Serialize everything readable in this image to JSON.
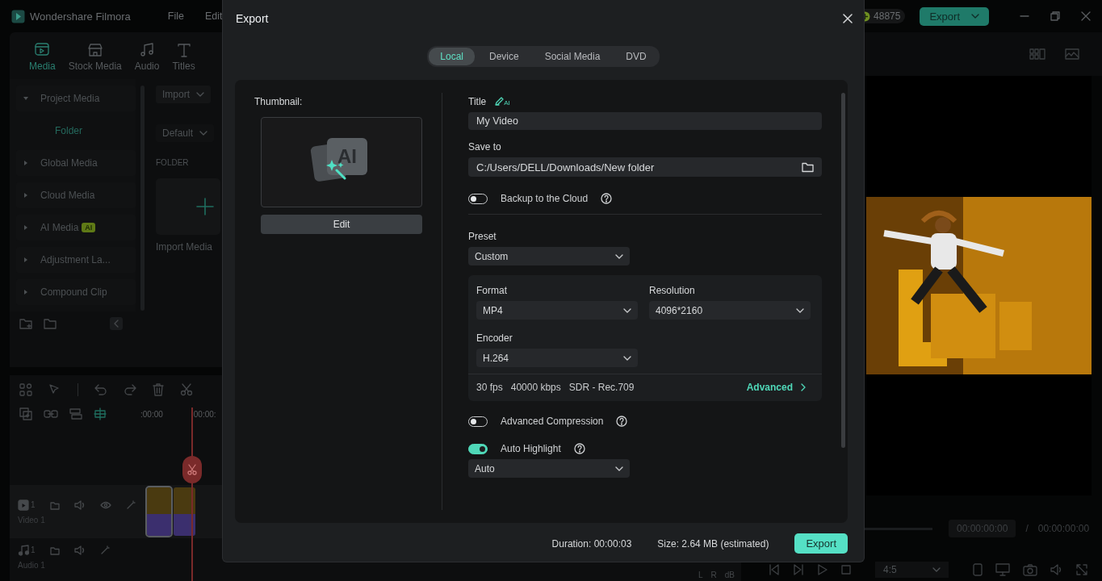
{
  "app": {
    "title": "Wondershare Filmora",
    "menu": [
      "File",
      "Edit"
    ],
    "credits": "48875",
    "export_button": "Export"
  },
  "media_tabs": [
    {
      "label": "Media",
      "selected": true
    },
    {
      "label": "Stock Media",
      "selected": false
    },
    {
      "label": "Audio",
      "selected": false
    },
    {
      "label": "Titles",
      "selected": false
    }
  ],
  "sidebar": {
    "items": [
      {
        "label": "Project Media",
        "expanded": true,
        "children": [
          {
            "label": "Folder",
            "selected": true
          }
        ]
      },
      {
        "label": "Global Media",
        "expanded": false
      },
      {
        "label": "Cloud Media",
        "expanded": false
      },
      {
        "label": "AI Media",
        "expanded": false,
        "badge": "AI"
      },
      {
        "label": "Adjustment La...",
        "expanded": false
      },
      {
        "label": "Compound Clip",
        "expanded": false
      }
    ]
  },
  "media_browser": {
    "import_button": "Import",
    "sort_button": "Default",
    "section": "FOLDER",
    "import_card": "Import Media"
  },
  "timeline": {
    "ruler": [
      ":00:00",
      "00:00:"
    ],
    "tracks": [
      {
        "kind": "video",
        "number": "1",
        "label": "Video 1"
      },
      {
        "kind": "audio",
        "number": "1",
        "label": "Audio 1"
      }
    ],
    "meter_unit": "dB",
    "channels": [
      "L",
      "R"
    ]
  },
  "preview": {
    "current_time": "00:00:00:00",
    "separator": "/",
    "total_time": "00:00:00:00",
    "aspect": "4:5"
  },
  "export_dialog": {
    "title": "Export",
    "tabs": [
      {
        "label": "Local",
        "selected": true
      },
      {
        "label": "Device",
        "selected": false
      },
      {
        "label": "Social Media",
        "selected": false
      },
      {
        "label": "DVD",
        "selected": false
      }
    ],
    "thumbnail_label": "Thumbnail:",
    "thumbnail_badge": "AI",
    "edit_button": "Edit",
    "title_label": "Title",
    "title_ai": "AI",
    "title_value": "My Video",
    "save_label": "Save to",
    "save_path": "C:/Users/DELL/Downloads/New folder",
    "backup": {
      "label": "Backup to the Cloud",
      "on": false
    },
    "preset": {
      "label": "Preset",
      "value": "Custom"
    },
    "format": {
      "label": "Format",
      "value": "MP4"
    },
    "resolution": {
      "label": "Resolution",
      "value": "4096*2160"
    },
    "encoder": {
      "label": "Encoder",
      "value": "H.264"
    },
    "summary": [
      "30 fps",
      "40000 kbps",
      "SDR - Rec.709"
    ],
    "advanced_link": "Advanced",
    "compression": {
      "label": "Advanced Compression",
      "on": false
    },
    "highlight": {
      "label": "Auto Highlight",
      "on": true,
      "value": "Auto"
    },
    "duration": "Duration:  00:00:03",
    "size": "Size:  2.64 MB  (estimated)",
    "export_button": "Export"
  }
}
